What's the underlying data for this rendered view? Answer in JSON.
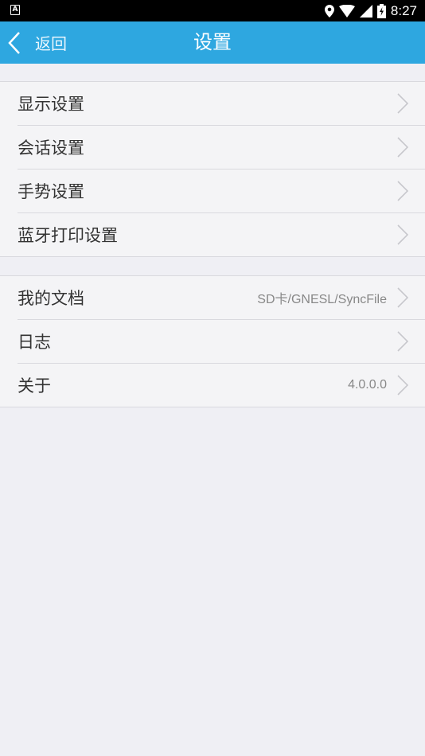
{
  "status_bar": {
    "left_icon": "A",
    "icons": [
      "location-icon",
      "wifi-icon",
      "signal-icon",
      "battery-icon"
    ],
    "time": "8:27"
  },
  "header": {
    "back_label": "返回",
    "title": "设置",
    "color": "#2ea7e0"
  },
  "groups": [
    {
      "items": [
        {
          "label": "显示设置",
          "value": ""
        },
        {
          "label": "会话设置",
          "value": ""
        },
        {
          "label": "手势设置",
          "value": ""
        },
        {
          "label": "蓝牙打印设置",
          "value": ""
        }
      ]
    },
    {
      "items": [
        {
          "label": "我的文档",
          "value": "SD卡/GNESL/SyncFile"
        },
        {
          "label": "日志",
          "value": ""
        },
        {
          "label": "关于",
          "value": "4.0.0.0"
        }
      ]
    }
  ]
}
